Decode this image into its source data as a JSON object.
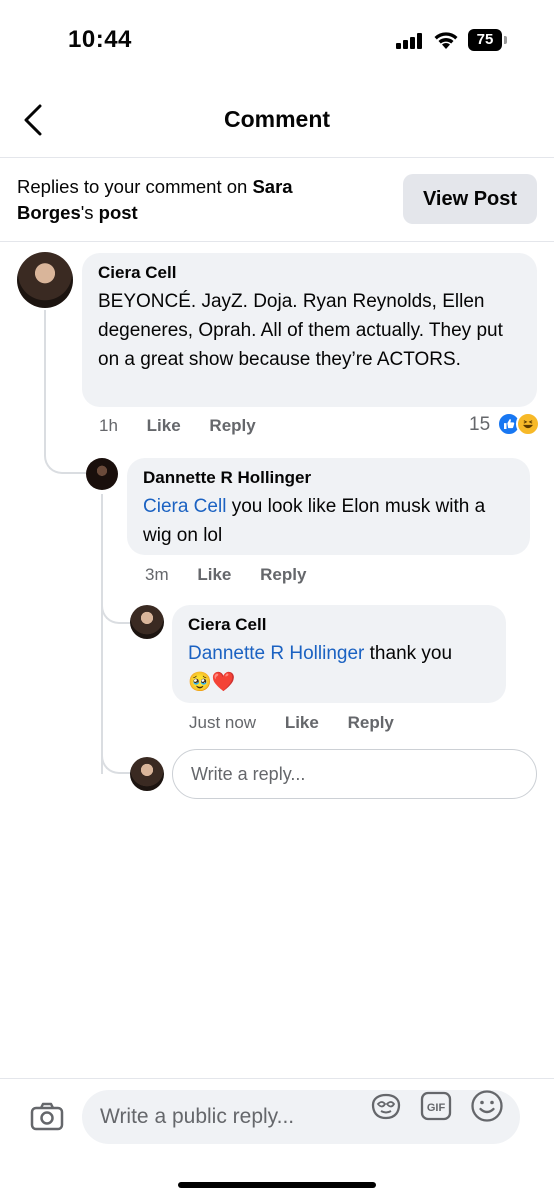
{
  "status_bar": {
    "time": "10:44",
    "battery": "75"
  },
  "nav": {
    "title": "Comment"
  },
  "context": {
    "prefix": "Replies to your comment on ",
    "author": "Sara Borges",
    "possessive": "'s ",
    "post": "post",
    "view_post_label": "View Post"
  },
  "comments": [
    {
      "author": "Ciera Cell",
      "text": "BEYONCÉ. JayZ. Doja. Ryan Reynolds, Ellen degeneres, Oprah. All of them actually. They put on a great show because they’re ACTORS.",
      "time": "1h",
      "like_label": "Like",
      "reply_label": "Reply",
      "reaction_count": "15"
    },
    {
      "author": "Dannette R Hollinger",
      "mention": "Ciera Cell",
      "text": " you look like Elon musk with a wig on lol",
      "time": "3m",
      "like_label": "Like",
      "reply_label": "Reply"
    },
    {
      "author": "Ciera Cell",
      "mention": "Dannette R Hollinger",
      "text": " thank you",
      "emojis": "🥹❤️",
      "time": "Just now",
      "like_label": "Like",
      "reply_label": "Reply"
    }
  ],
  "reply_box": {
    "placeholder": "Write a reply..."
  },
  "composer": {
    "placeholder": "Write a public reply..."
  },
  "icons": {
    "back": "chevron-left-icon",
    "camera": "camera-icon",
    "sticker": "sticker-icon",
    "gif": "gif-icon",
    "emoji": "emoji-icon"
  },
  "colors": {
    "mention": "#1b62c2",
    "like_reaction": "#1877f2",
    "haha_reaction": "#f7b928"
  }
}
